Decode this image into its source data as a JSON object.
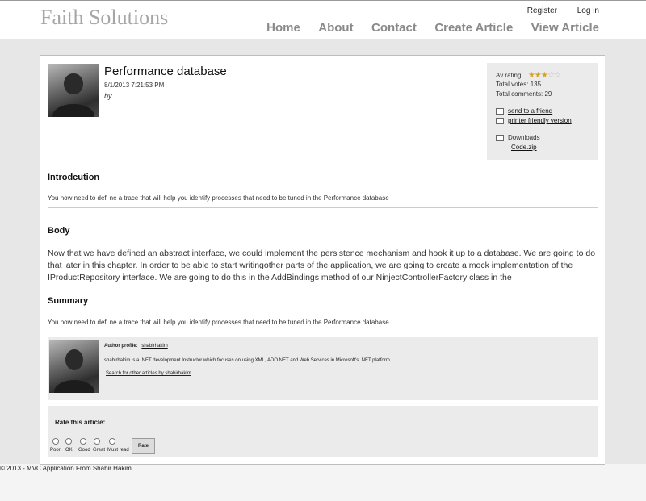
{
  "site": {
    "title": "Faith Solutions"
  },
  "account": {
    "register": "Register",
    "login": "Log in"
  },
  "nav": [
    "Home",
    "About",
    "Contact",
    "Create Article",
    "View Article"
  ],
  "article": {
    "title": "Performance database",
    "date": "8/1/2013 7:21:53 PM",
    "by": "by"
  },
  "sidebar": {
    "rating_label": "Av rating:",
    "rating_stars": 3,
    "rating_max": 5,
    "total_votes": "Total votes: 135",
    "total_comments": "Total comments: 29",
    "send_friend": "send to a friend",
    "printer": "printer friendly version",
    "downloads_label": "Downloads",
    "download_file": "Code.zip"
  },
  "sections": {
    "intro_heading": "Introdcution",
    "intro_text": "You now need to defi ne a trace that will help you identify processes that need to be tuned in the Performance database",
    "body_heading": "Body",
    "body_text": "Now that we have defined an abstract interface, we could implement the persistence mechanism and hook it up to a database. We are going to do that later in this chapter. In order to be able to start writingother parts of the application, we are going to create a mock implementation of the IProductRepository interface. We are going to do this in the AddBindings method of our NinjectControllerFactory class in the",
    "summary_heading": "Summary",
    "summary_text": "You now need to defi ne a trace that will help you identify processes that need to be tuned in the Performance database"
  },
  "author": {
    "profile_label": "Author profile:",
    "name": "shabirhakim",
    "bio": "shabirhakim is a .NET development Instructor which focuses on using XML, ADO.NET and Web Services in Microsoft's .NET platform.",
    "search_link": "Search for other articles by shabirhakim"
  },
  "rate": {
    "title": "Rate this article:",
    "options": [
      "Poor",
      "OK",
      "Good",
      "Great",
      "Must read"
    ],
    "button": "Rate"
  },
  "footer": {
    "text": "© 2013 - MVC Application From Shabir Hakim"
  },
  "colors": {
    "nav_text": "#8a8a8a",
    "star": "#d4a12a",
    "panel": "#ebebeb"
  }
}
